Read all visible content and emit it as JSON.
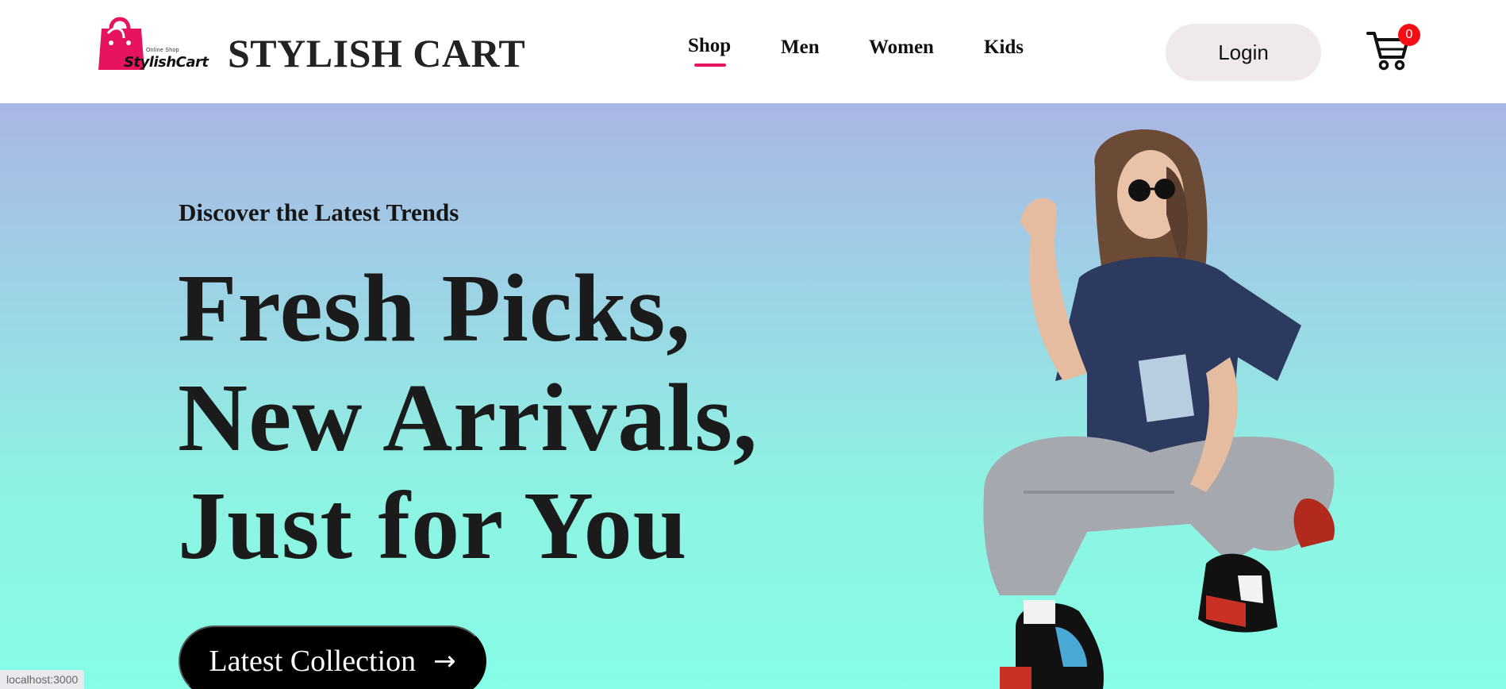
{
  "header": {
    "logo": {
      "tagline": "Online Shop",
      "wordmark": "StylishCart"
    },
    "brand": "STYLISH CART",
    "nav": [
      {
        "label": "Shop",
        "active": true
      },
      {
        "label": "Men",
        "active": false
      },
      {
        "label": "Women",
        "active": false
      },
      {
        "label": "Kids",
        "active": false
      }
    ],
    "login_label": "Login",
    "cart_count": "0"
  },
  "hero": {
    "subtitle": "Discover the Latest Trends",
    "headline": [
      "Fresh Picks,",
      "New Arrivals,",
      "Just for You"
    ],
    "cta_label": "Latest Collection",
    "cta_arrow": "→"
  },
  "status_bar": {
    "url": "localhost:3000"
  },
  "colors": {
    "accent": "#e6145f",
    "badge": "#f40d14",
    "login_bg": "#efe9e9",
    "hero_top": "#aab6e4",
    "hero_bottom": "#86fde6",
    "cta_bg": "#000000"
  },
  "icons": [
    "shopping-bag-logo-icon",
    "cart-icon",
    "arrow-right-icon"
  ]
}
